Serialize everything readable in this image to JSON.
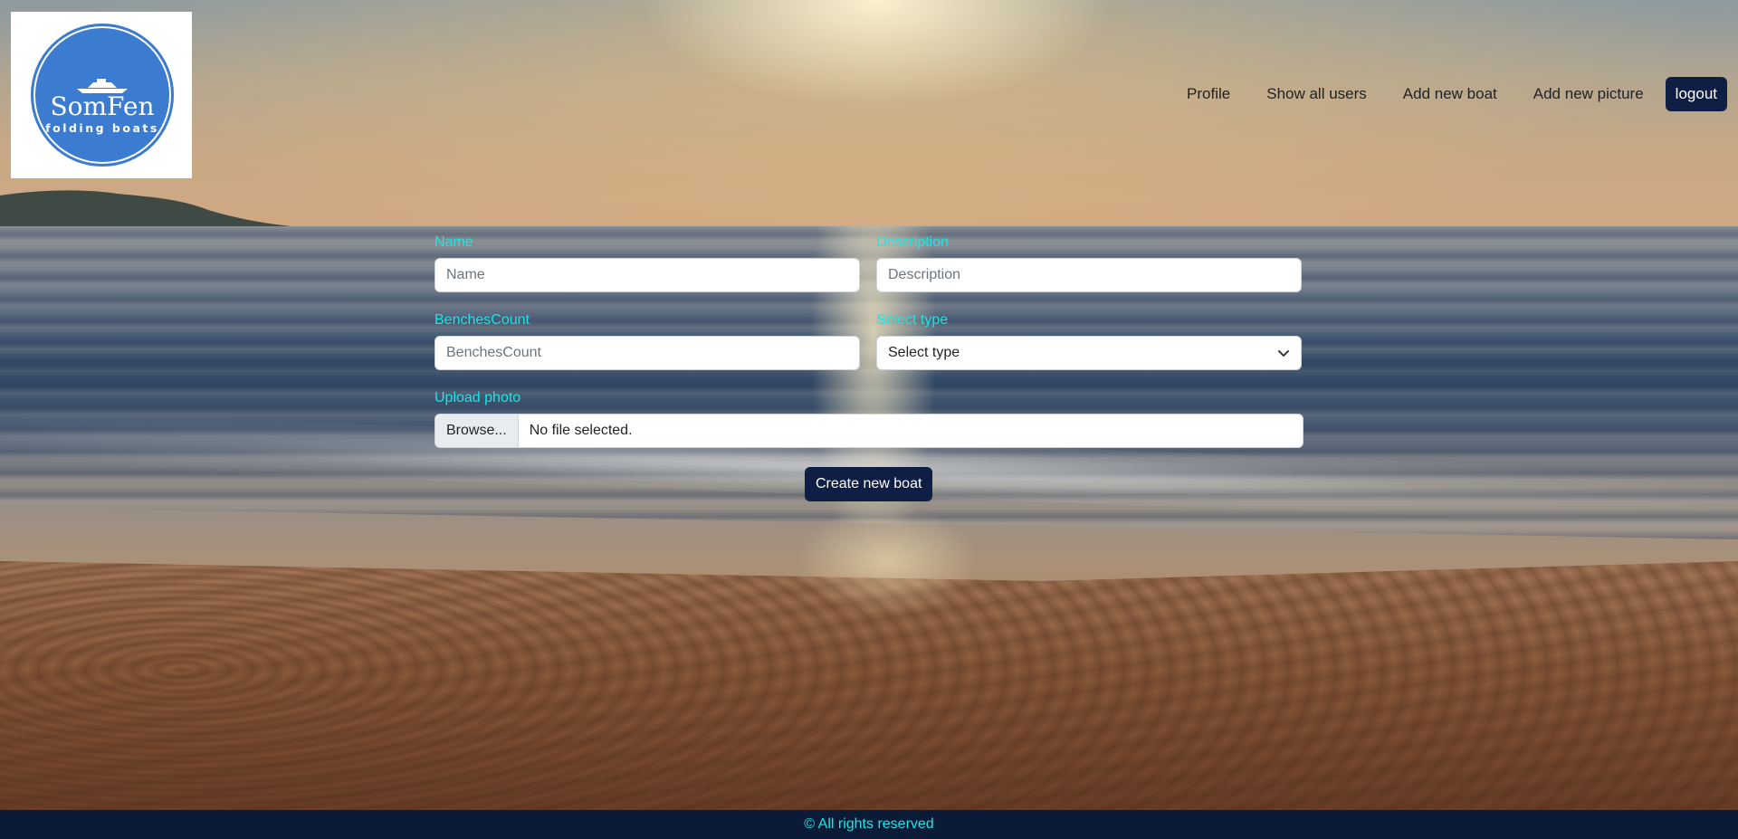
{
  "logo": {
    "name": "SomFen",
    "subtitle": "folding boats"
  },
  "nav": {
    "links": [
      "Profile",
      "Show all users",
      "Add new boat",
      "Add new picture"
    ],
    "logout_label": "logout"
  },
  "form": {
    "name": {
      "label": "Name",
      "placeholder": "Name"
    },
    "description": {
      "label": "Description",
      "placeholder": "Description"
    },
    "benches": {
      "label": "BenchesCount",
      "placeholder": "BenchesCount"
    },
    "type": {
      "label": "Select type",
      "selected": "Select type"
    },
    "photo": {
      "label": "Upload photo",
      "browse_label": "Browse...",
      "status": "No file selected."
    },
    "submit_label": "Create new boat"
  },
  "footer": {
    "text": "© All rights reserved"
  },
  "colors": {
    "label": "#19e6e6",
    "button": "#0f1e44",
    "footer_bg": "#0b1a36",
    "logo_blue": "#3b7bd0"
  }
}
